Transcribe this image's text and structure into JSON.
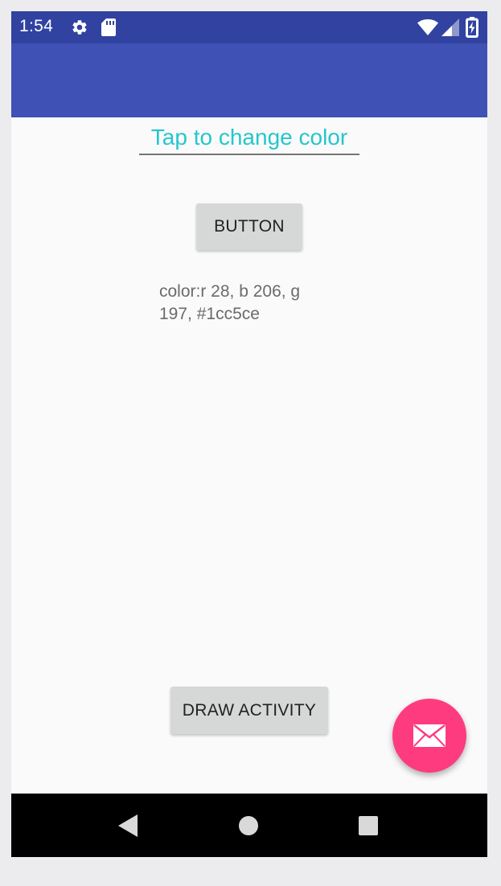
{
  "status_bar": {
    "time": "1:54",
    "icons": [
      "gear-icon",
      "sd-card-icon",
      "wifi-icon",
      "signal-icon",
      "battery-charging-icon"
    ],
    "color": "#3142a0"
  },
  "app_bar": {
    "color": "#3f51b5"
  },
  "main": {
    "color_input": {
      "value": "Tap to change color",
      "text_color": "#26c6cc"
    },
    "button_label": "BUTTON",
    "color_info": "color:r 28, b 206, g 197, #1cc5ce",
    "draw_activity_label": "DRAW ACTIVITY"
  },
  "fab": {
    "icon": "mail-icon",
    "color": "#ff3b80"
  },
  "nav_bar": {
    "icons": [
      "back-icon",
      "home-icon",
      "recents-icon"
    ]
  }
}
